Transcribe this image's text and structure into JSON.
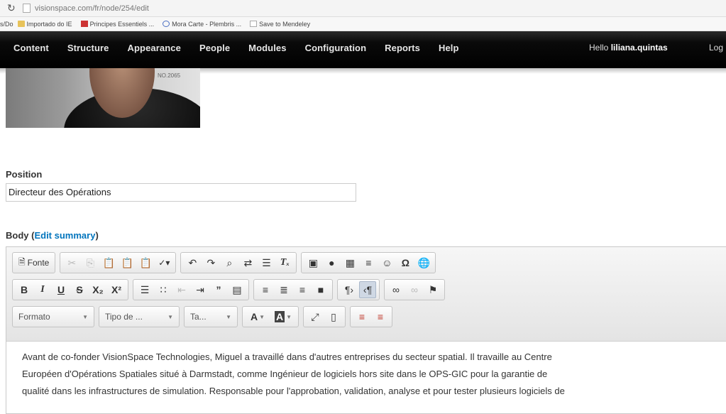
{
  "browser": {
    "url": "visionspace.com/fr/node/254/edit",
    "bookmarks": [
      "Importado do IE",
      "Principes Essentiels ...",
      "Mora Carte - Plembris ...",
      "Save to Mendeley"
    ],
    "bookmarks_prefix": "s/Do"
  },
  "admin_menu": {
    "items": [
      "Content",
      "Structure",
      "Appearance",
      "People",
      "Modules",
      "Configuration",
      "Reports",
      "Help"
    ],
    "hello_prefix": "Hello",
    "username": "liliana.quintas",
    "logout": "Log"
  },
  "photo": {
    "badge": "NO.2065"
  },
  "position": {
    "label": "Position",
    "value": "Directeur des Opérations"
  },
  "body": {
    "label": "Body",
    "open_paren": " (",
    "edit_summary": "Edit summary",
    "close_paren": ")"
  },
  "toolbar": {
    "source_label": "Fonte",
    "format_label": "Formato",
    "font_label": "Tipo de ...",
    "size_label": "Ta...",
    "accent": "#cfd8e4"
  },
  "content": {
    "lines": [
      "Avant de co-fonder VisionSpace Technologies, Miguel a travaillé dans d'autres entreprises du secteur spatial. Il travaille au Centre",
      "Européen d'Opérations Spatiales situé à Darmstadt, comme Ingénieur de logiciels hors site dans le OPS-GIC pour la garantie de",
      "qualité dans les infrastructures de simulation. Responsable pour l'approbation, validation, analyse et pour tester plusieurs logiciels de"
    ]
  }
}
